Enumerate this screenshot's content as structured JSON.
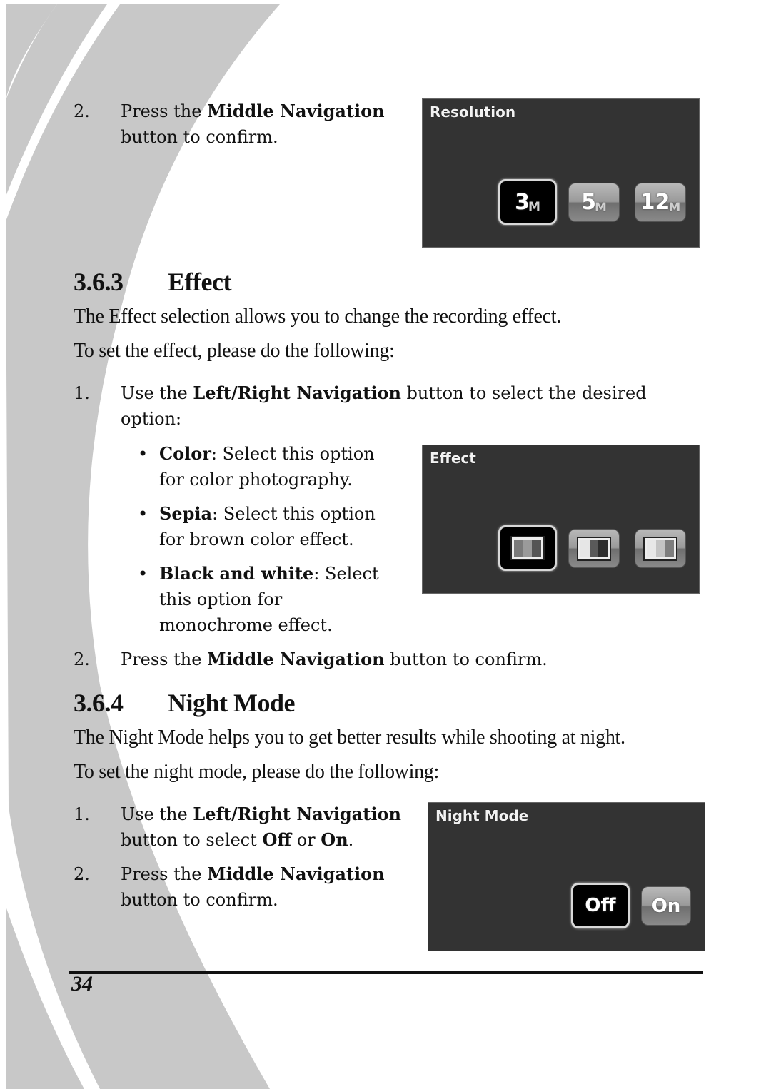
{
  "colors": {
    "page_background": "#ffffff",
    "decoration_gray": "#c8c8c8",
    "screen_background": "#333333",
    "text": "#111111"
  },
  "top_list": {
    "item2": {
      "number": "2.",
      "pre": "Press the ",
      "bold": "Middle Navigation",
      "line2": "button to confirm."
    }
  },
  "resolution_screen": {
    "title": "Resolution",
    "options": [
      {
        "value": "3",
        "unit": "M",
        "selected": true
      },
      {
        "value": "5",
        "unit": "M",
        "selected": false
      },
      {
        "value": "12",
        "unit": "M",
        "selected": false
      }
    ]
  },
  "effect_section": {
    "number": "3.6.3",
    "title": "Effect",
    "intro": "The Effect selection allows you to change the recording effect.",
    "instruction": "To set the effect, please do the following:",
    "step1": {
      "number": "1.",
      "pre": "Use the ",
      "bold": "Left/Right Navigation",
      "post": " button to select the desired",
      "line2": "option:"
    },
    "bullets": [
      {
        "bold": "Color",
        "line1": ": Select this option",
        "line2": "for color photography.",
        "line3": ""
      },
      {
        "bold": "Sepia",
        "line1": ": Select this option",
        "line2": "for brown color effect.",
        "line3": ""
      },
      {
        "bold": "Black and white",
        "line1": ": Select",
        "line2": "this option for",
        "line3": "monochrome effect."
      }
    ],
    "step2": {
      "number": "2.",
      "pre": "Press the ",
      "bold": "Middle Navigation",
      "post": " button to confirm."
    }
  },
  "effect_screen": {
    "title": "Effect",
    "options": [
      {
        "name": "color",
        "selected": true
      },
      {
        "name": "sepia",
        "selected": false
      },
      {
        "name": "black-and-white",
        "selected": false
      }
    ]
  },
  "night_section": {
    "number": "3.6.4",
    "title": "Night Mode",
    "intro": "The Night Mode helps you to get better results while shooting at night.",
    "instruction": "To set the night mode, please do the following:",
    "step1": {
      "number": "1.",
      "pre": "Use the ",
      "bold": "Left/Right Navigation",
      "line2_pre": "button to select ",
      "off": "Off",
      "or": " or ",
      "on": "On",
      "end": "."
    },
    "step2": {
      "number": "2.",
      "pre": "Press the ",
      "bold": "Middle Navigation",
      "line2": "button to confirm."
    }
  },
  "night_screen": {
    "title": "Night Mode",
    "options": [
      {
        "label": "Off",
        "selected": true
      },
      {
        "label": "On",
        "selected": false
      }
    ]
  },
  "footer": {
    "page_number": "34"
  }
}
